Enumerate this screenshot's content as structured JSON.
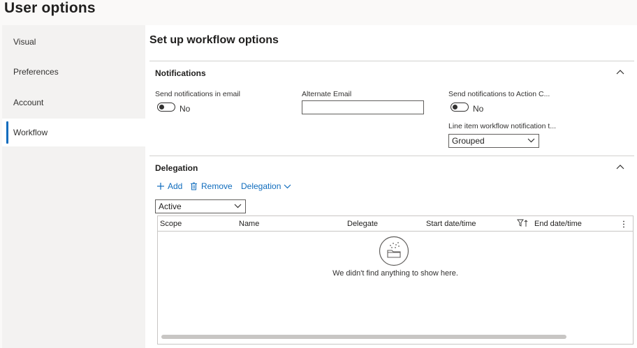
{
  "page": {
    "title": "User options"
  },
  "sidebar": {
    "items": [
      {
        "label": "Visual"
      },
      {
        "label": "Preferences"
      },
      {
        "label": "Account"
      },
      {
        "label": "Workflow"
      }
    ],
    "active": "Workflow"
  },
  "main": {
    "title": "Set up workflow options",
    "notifications": {
      "header": "Notifications",
      "send_email_label": "Send notifications in email",
      "send_email_value": "No",
      "alternate_email_label": "Alternate Email",
      "alternate_email_value": "",
      "action_center_label": "Send notifications to Action C...",
      "action_center_value": "No",
      "line_item_label": "Line item workflow notification t...",
      "line_item_value": "Grouped"
    },
    "delegation": {
      "header": "Delegation",
      "add_label": "Add",
      "remove_label": "Remove",
      "menu_label": "Delegation",
      "filter_value": "Active",
      "columns": [
        "Scope",
        "Name",
        "Delegate",
        "Start date/time",
        "End date/time"
      ],
      "empty_text": "We didn't find anything to show here."
    }
  },
  "colors": {
    "accent": "#0f6cbd",
    "sidebar_bg": "#f3f2f1"
  }
}
